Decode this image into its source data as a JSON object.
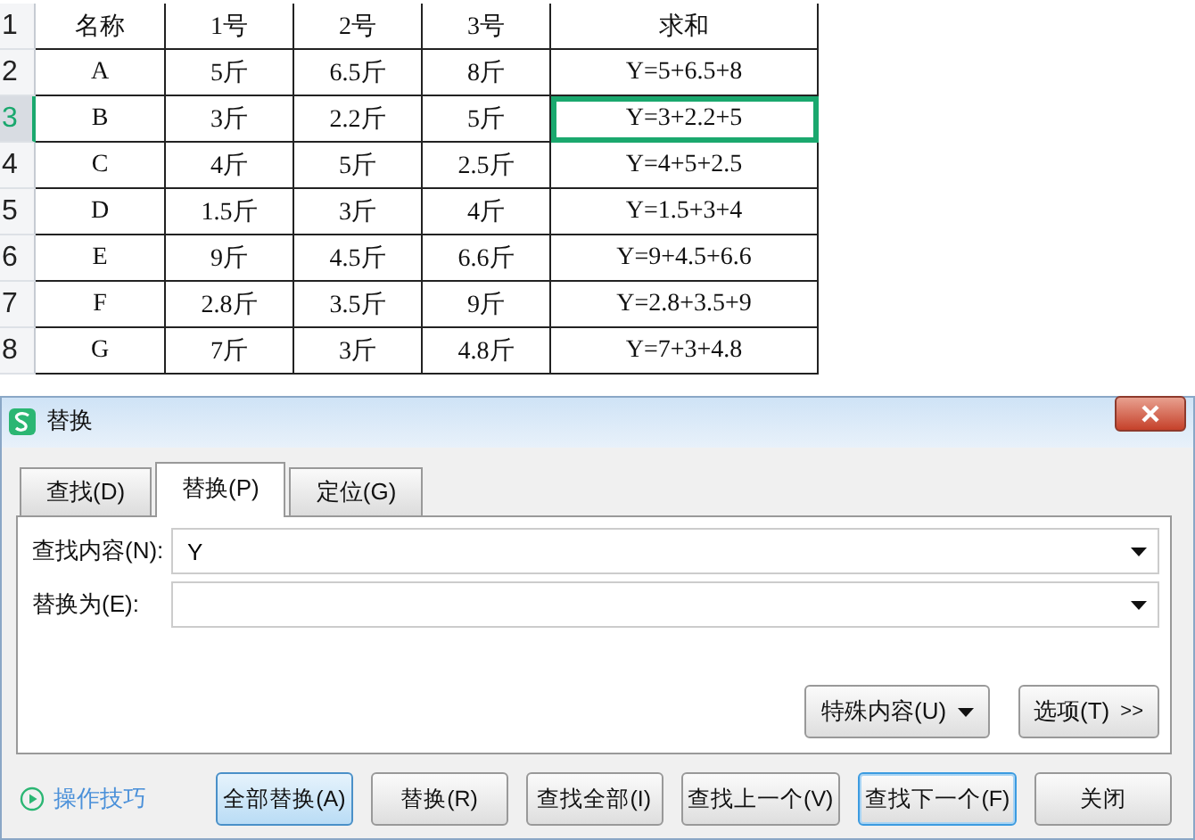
{
  "sheet": {
    "rows": [
      {
        "number": "1",
        "selected": false,
        "cells": [
          {
            "text": "名称",
            "selected": false
          },
          {
            "text": "1号",
            "selected": false
          },
          {
            "text": "2号",
            "selected": false
          },
          {
            "text": "3号",
            "selected": false
          },
          {
            "text": "求和",
            "selected": false
          }
        ]
      },
      {
        "number": "2",
        "selected": false,
        "cells": [
          {
            "text": "A",
            "selected": false
          },
          {
            "text": "5斤",
            "selected": false
          },
          {
            "text": "6.5斤",
            "selected": false
          },
          {
            "text": "8斤",
            "selected": false
          },
          {
            "text": "Y=5+6.5+8",
            "selected": false
          }
        ]
      },
      {
        "number": "3",
        "selected": true,
        "cells": [
          {
            "text": "B",
            "selected": false
          },
          {
            "text": "3斤",
            "selected": false
          },
          {
            "text": "2.2斤",
            "selected": false
          },
          {
            "text": "5斤",
            "selected": false
          },
          {
            "text": "Y=3+2.2+5",
            "selected": true
          }
        ]
      },
      {
        "number": "4",
        "selected": false,
        "cells": [
          {
            "text": "C",
            "selected": false
          },
          {
            "text": "4斤",
            "selected": false
          },
          {
            "text": "5斤",
            "selected": false
          },
          {
            "text": "2.5斤",
            "selected": false
          },
          {
            "text": "Y=4+5+2.5",
            "selected": false
          }
        ]
      },
      {
        "number": "5",
        "selected": false,
        "cells": [
          {
            "text": "D",
            "selected": false
          },
          {
            "text": "1.5斤",
            "selected": false
          },
          {
            "text": "3斤",
            "selected": false
          },
          {
            "text": "4斤",
            "selected": false
          },
          {
            "text": "Y=1.5+3+4",
            "selected": false
          }
        ]
      },
      {
        "number": "6",
        "selected": false,
        "cells": [
          {
            "text": "E",
            "selected": false
          },
          {
            "text": "9斤",
            "selected": false
          },
          {
            "text": "4.5斤",
            "selected": false
          },
          {
            "text": "6.6斤",
            "selected": false
          },
          {
            "text": "Y=9+4.5+6.6",
            "selected": false
          }
        ]
      },
      {
        "number": "7",
        "selected": false,
        "cells": [
          {
            "text": "F",
            "selected": false
          },
          {
            "text": "2.8斤",
            "selected": false
          },
          {
            "text": "3.5斤",
            "selected": false
          },
          {
            "text": "9斤",
            "selected": false
          },
          {
            "text": "Y=2.8+3.5+9",
            "selected": false
          }
        ]
      },
      {
        "number": "8",
        "selected": false,
        "cells": [
          {
            "text": "G",
            "selected": false
          },
          {
            "text": "7斤",
            "selected": false
          },
          {
            "text": "3斤",
            "selected": false
          },
          {
            "text": "4.8斤",
            "selected": false
          },
          {
            "text": "Y=7+3+4.8",
            "selected": false
          }
        ]
      }
    ]
  },
  "dialog": {
    "title": "替换",
    "tabs": [
      {
        "label": "查找(D)",
        "selected": false
      },
      {
        "label": "替换(P)",
        "selected": true
      },
      {
        "label": "定位(G)",
        "selected": false
      }
    ],
    "fields": [
      {
        "label": "查找内容(N):",
        "value": "Y"
      },
      {
        "label": "替换为(E):"
      }
    ],
    "option_buttons": [
      {
        "label": "特殊内容(U)",
        "kind": "dropdown"
      },
      {
        "label": "选项(T)",
        "kind": "expand",
        "suffix": ">>"
      }
    ],
    "help_link": "操作技巧",
    "buttons": [
      {
        "label": "全部替换(A)",
        "highlighted": true,
        "focused": false
      },
      {
        "label": "替换(R)",
        "highlighted": false,
        "focused": false
      },
      {
        "label": "查找全部(I)",
        "highlighted": false,
        "focused": false
      },
      {
        "label": "查找上一个(V)",
        "highlighted": false,
        "focused": false
      },
      {
        "label": "查找下一个(F)",
        "highlighted": false,
        "focused": true
      },
      {
        "label": "关闭",
        "highlighted": false,
        "focused": false
      }
    ]
  }
}
